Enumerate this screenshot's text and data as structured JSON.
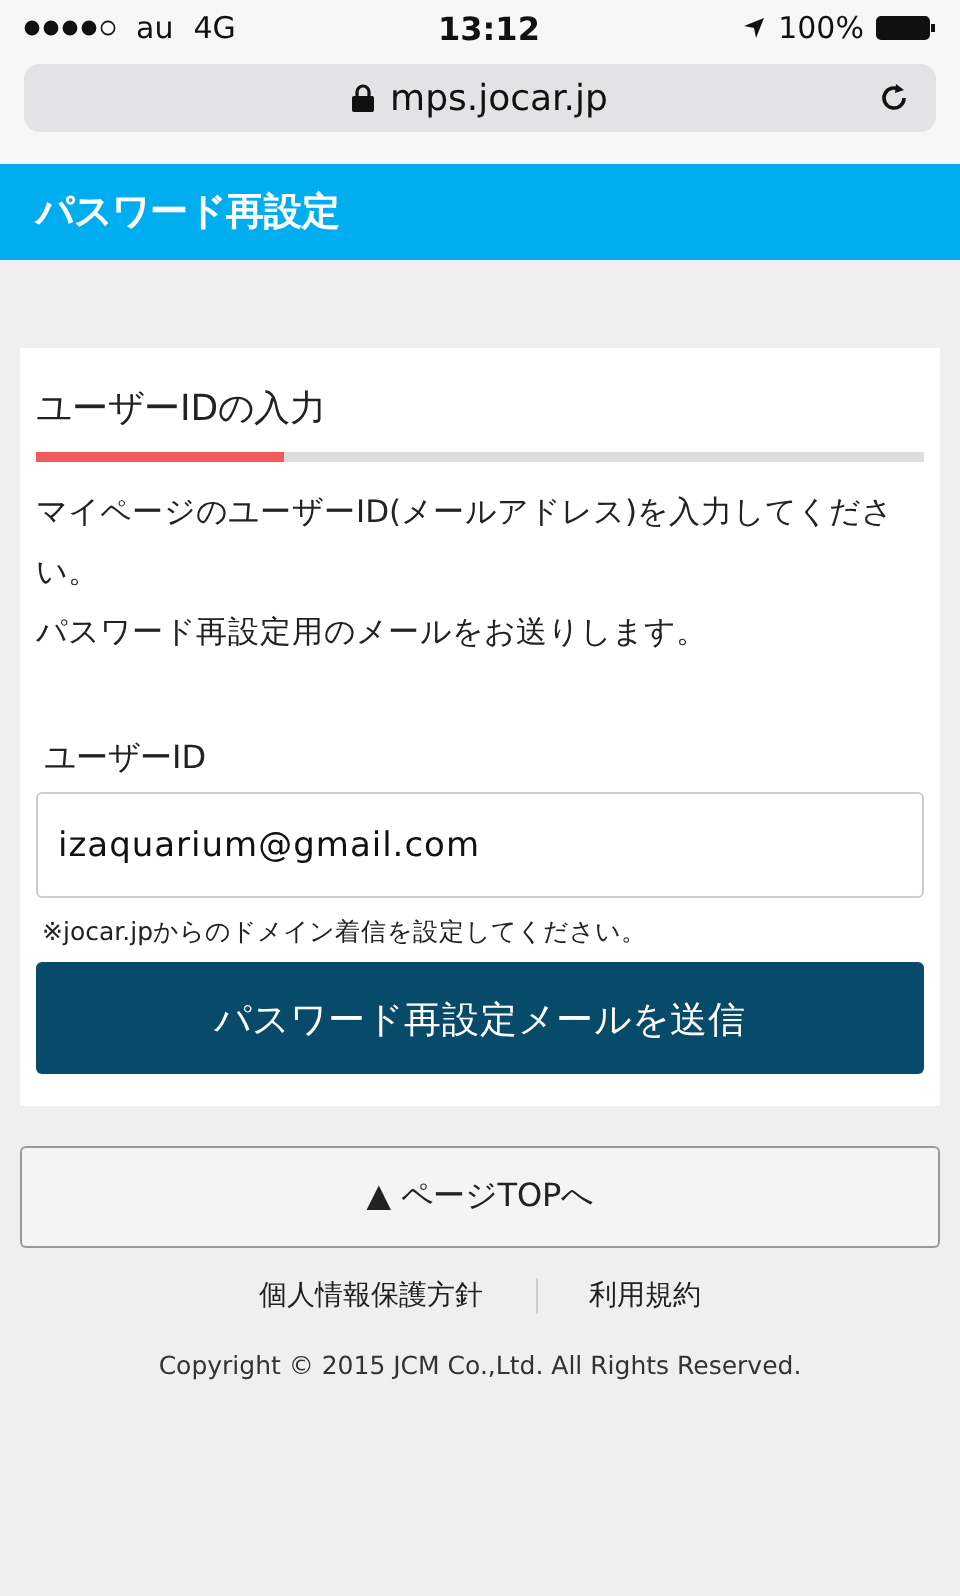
{
  "status_bar": {
    "carrier": "au",
    "network": "4G",
    "time": "13:12",
    "battery": "100%"
  },
  "address_bar": {
    "url": "mps.jocar.jp"
  },
  "header": {
    "title": "パスワード再設定"
  },
  "card": {
    "title": "ユーザーIDの入力",
    "progress": {
      "level": 0.28
    },
    "description": [
      "マイページのユーザーID(メールアドレス)を入力してください。",
      "パスワード再設定用のメールをお送りします。"
    ],
    "field": {
      "label": "ユーザーID",
      "value": "izaquarium@gmail.com"
    },
    "note": "※jocar.jpからのドメイン着信を設定してください。",
    "submit": "パスワード再設定メールを送信"
  },
  "page_top": "▲ ページTOPへ",
  "footer": {
    "links": [
      "個人情報保護方針",
      "利用規約"
    ],
    "copyright": "Copyright © 2015 JCM Co.,Ltd. All Rights Reserved."
  }
}
